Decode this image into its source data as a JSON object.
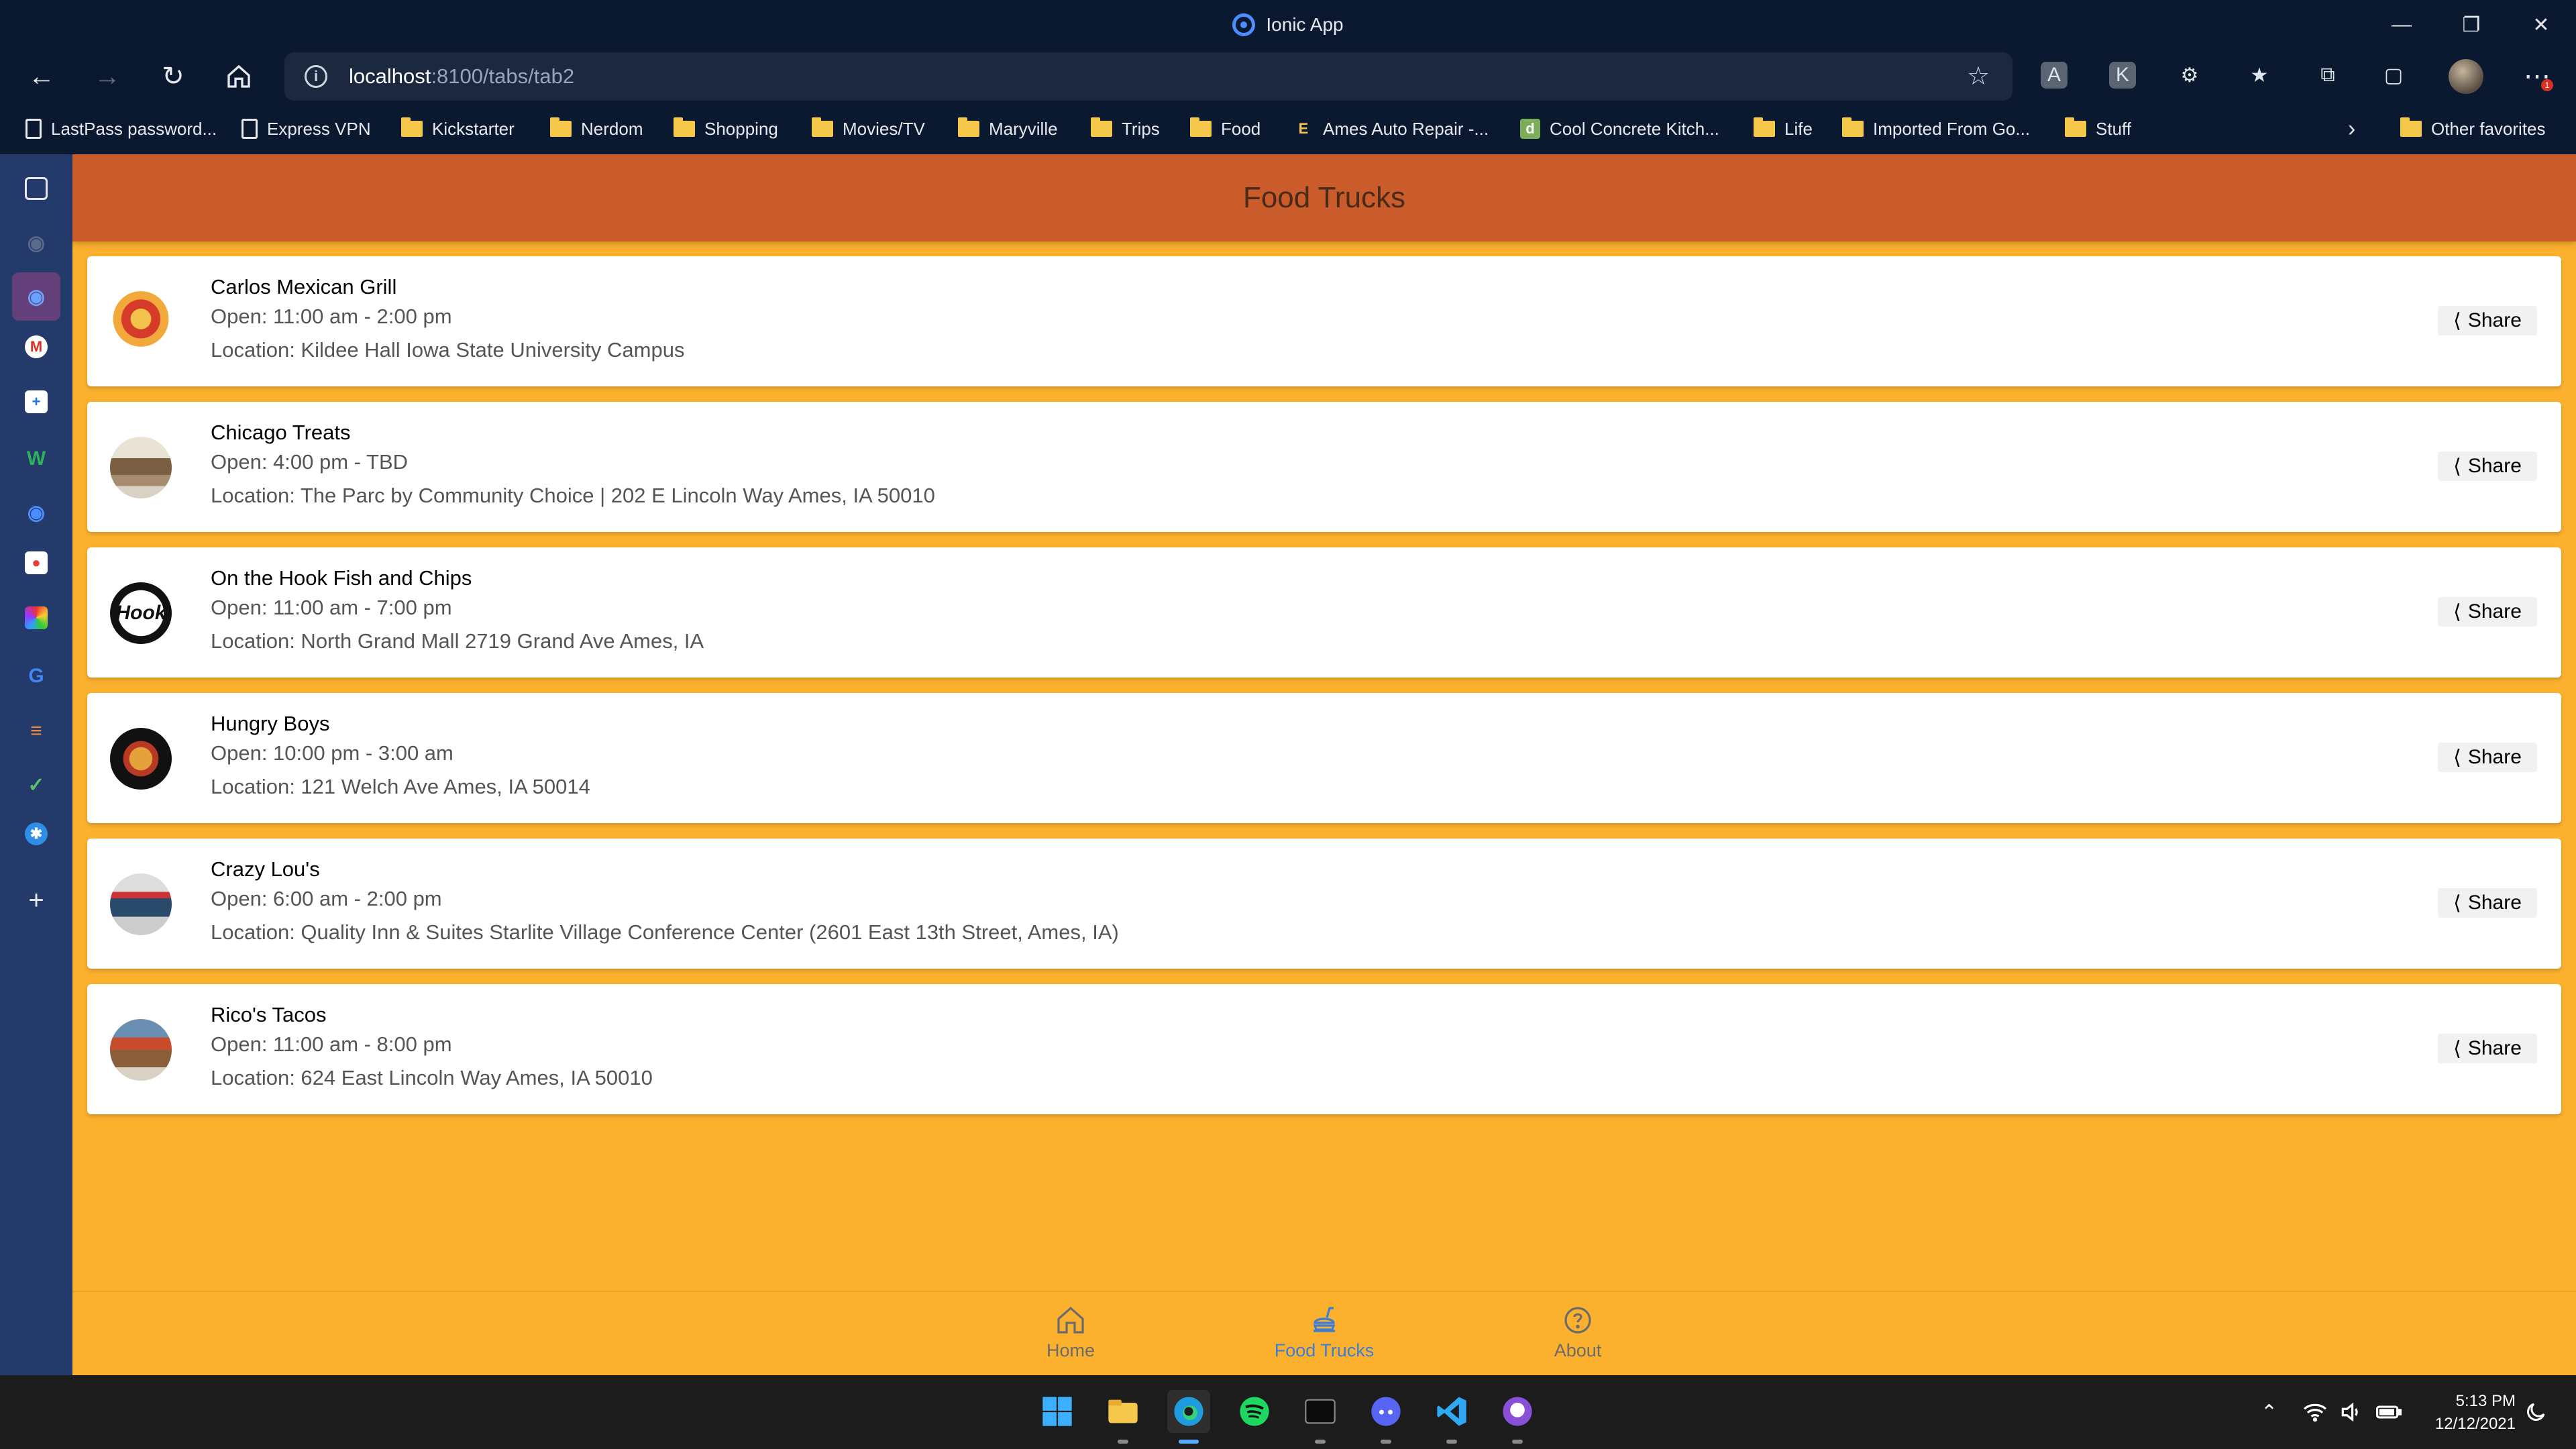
{
  "browser": {
    "window_title": "Ionic App",
    "address": {
      "host": "localhost",
      "path": ":8100/tabs/tab2"
    },
    "favorites": [
      {
        "label": "LastPass password...",
        "icon": "page-icon"
      },
      {
        "label": "Express VPN",
        "icon": "page-icon"
      },
      {
        "label": "Kickstarter",
        "icon": "folder-icon"
      },
      {
        "label": "Nerdom",
        "icon": "folder-icon"
      },
      {
        "label": "Shopping",
        "icon": "folder-icon"
      },
      {
        "label": "Movies/TV",
        "icon": "folder-icon"
      },
      {
        "label": "Maryville",
        "icon": "folder-icon"
      },
      {
        "label": "Trips",
        "icon": "folder-icon"
      },
      {
        "label": "Food",
        "icon": "folder-icon"
      },
      {
        "label": "Ames Auto Repair -...",
        "icon": "site-icon"
      },
      {
        "label": "Cool Concrete Kitch...",
        "icon": "site-icon"
      },
      {
        "label": "Life",
        "icon": "folder-icon"
      },
      {
        "label": "Imported From Go...",
        "icon": "folder-icon"
      },
      {
        "label": "Stuff",
        "icon": "folder-icon"
      }
    ],
    "other_favorites": "Other favorites",
    "notification_count": "1"
  },
  "app": {
    "header_title": "Food Trucks",
    "trucks": [
      {
        "name": "Carlos Mexican Grill",
        "hours": "Open: 11:00 am - 2:00 pm",
        "location": "Location: Kildee Hall Iowa State University Campus",
        "share": "Share"
      },
      {
        "name": "Chicago Treats",
        "hours": "Open: 4:00 pm - TBD",
        "location": "Location: The Parc by Community Choice | 202 E Lincoln Way Ames, IA 50010",
        "share": "Share"
      },
      {
        "name": "On the Hook Fish and Chips",
        "hours": "Open: 11:00 am - 7:00 pm",
        "location": "Location: North Grand Mall 2719 Grand Ave Ames, IA",
        "share": "Share",
        "logo_text": "Hook"
      },
      {
        "name": "Hungry Boys",
        "hours": "Open: 10:00 pm - 3:00 am",
        "location": "Location: 121 Welch Ave Ames, IA 50014",
        "share": "Share"
      },
      {
        "name": "Crazy Lou's",
        "hours": "Open: 6:00 am - 2:00 pm",
        "location": "Location: Quality Inn & Suites Starlite Village Conference Center (2601 East 13th Street, Ames, IA)",
        "share": "Share"
      },
      {
        "name": "Rico's Tacos",
        "hours": "Open: 11:00 am - 8:00 pm",
        "location": "Location: 624 East Lincoln Way Ames, IA 50010",
        "share": "Share"
      }
    ],
    "tabs": [
      {
        "label": "Home",
        "icon": "home-icon"
      },
      {
        "label": "Food Trucks",
        "icon": "fastfood-icon"
      },
      {
        "label": "About",
        "icon": "help-circle-icon"
      }
    ],
    "colors": {
      "header": "#c95c2a",
      "background": "#fbb12e",
      "active_tab": "#3e7cd6"
    }
  },
  "taskbar": {
    "time": "5:13 PM",
    "date": "12/12/2021"
  }
}
